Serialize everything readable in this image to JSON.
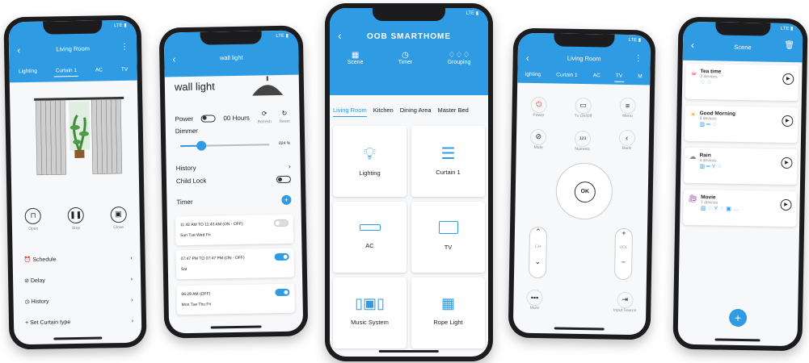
{
  "colors": {
    "accent": "#2f9be3",
    "accent_dark": "#1f87d0"
  },
  "status": {
    "signal": "LTE"
  },
  "p1": {
    "title": "Living Room",
    "tabs": [
      "Lighting",
      "Curtain 1",
      "AC",
      "TV"
    ],
    "controls": [
      {
        "label": "Open",
        "icon": "open-icon"
      },
      {
        "label": "Stop",
        "icon": "pause-icon"
      },
      {
        "label": "Close",
        "icon": "close-curtain-icon"
      }
    ],
    "menu": [
      {
        "label": "Schedule",
        "icon": "clock-icon"
      },
      {
        "label": "Delay",
        "icon": "delay-icon"
      },
      {
        "label": "History",
        "icon": "history-icon"
      },
      {
        "label": "Set Curtain type",
        "icon": "plus-icon"
      }
    ]
  },
  "p2": {
    "header": "wall light",
    "device_name": "wall light",
    "power_label": "Power",
    "power_hours": "00 Hours",
    "refresh": "Refresh",
    "reset": "Reset",
    "dimmer_label": "Dimmer",
    "dimmer_value": "024 %",
    "dimmer_level": 0.24,
    "history": "History",
    "child_lock": "Child Lock",
    "timer": "Timer",
    "timers": [
      {
        "time": "11:42 AM  TO  11:43 AM  (ON - OFF)",
        "days": "Sun Tue Wed Fri",
        "on": false
      },
      {
        "time": "07:47 PM  TO  07:47 PM  (ON - OFF)",
        "days": "Sat",
        "on": true
      },
      {
        "time": "06:29 AM  (OFF)",
        "days": "Mon Tue Thu Fri",
        "on": true
      }
    ]
  },
  "p3": {
    "brand": "OOB SMARTHOME",
    "nav": [
      {
        "label": "Scene",
        "icon": "scene-icon"
      },
      {
        "label": "Timer",
        "icon": "timer-icon"
      },
      {
        "label": "Grouping",
        "icon": "bulbs-icon"
      }
    ],
    "rooms": [
      "Living Room",
      "Kitchen",
      "Dining Area",
      "Master Bed"
    ],
    "devices": [
      {
        "label": "Lighting",
        "icon": "bulb-icon"
      },
      {
        "label": "Curtain 1",
        "icon": "curtain-icon"
      },
      {
        "label": "AC",
        "icon": "ac-icon"
      },
      {
        "label": "TV",
        "icon": "tv-icon"
      },
      {
        "label": "Music System",
        "icon": "speakers-icon"
      },
      {
        "label": "Rope Light",
        "icon": "rope-light-icon"
      }
    ]
  },
  "p4": {
    "title": "Living Room",
    "tabs": [
      "ighting",
      "Curtain 1",
      "AC",
      "TV",
      "M"
    ],
    "top_buttons": [
      {
        "label": "Power",
        "icon": "power-icon"
      },
      {
        "label": "Tv On/Off",
        "icon": "tv-onoff-icon"
      },
      {
        "label": "Menu",
        "icon": "menu-icon"
      }
    ],
    "mid_buttons": [
      {
        "label": "Mute",
        "icon": "mute-icon"
      },
      {
        "label": "Numeric",
        "icon": "numeric-icon",
        "glyph": "123"
      },
      {
        "label": "Back",
        "icon": "back-icon"
      }
    ],
    "ok": "OK",
    "ch": "CH",
    "vol": "VOL",
    "more": "More",
    "input_source": "Input Source"
  },
  "p5": {
    "title": "Scene",
    "scenes": [
      {
        "name": "Tea time",
        "devices": "2 devices",
        "icon": "tea-cup-icon"
      },
      {
        "name": "Good Morning",
        "devices": "3 devices",
        "icon": "sun-icon"
      },
      {
        "name": "Rain",
        "devices": "4 devices",
        "icon": "cloud-rain-icon"
      },
      {
        "name": "Movie",
        "devices": "7 devices",
        "icon": "video-camera-icon"
      }
    ],
    "fab": "+"
  }
}
